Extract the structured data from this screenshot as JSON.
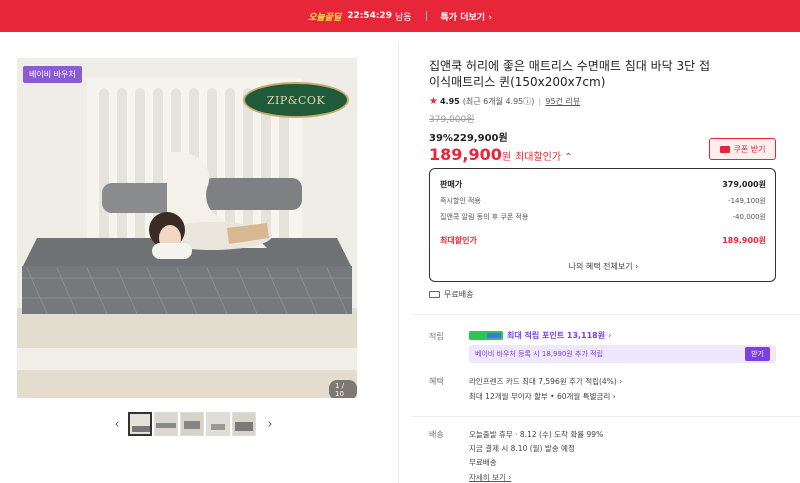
{
  "topbar": {
    "brand": "오늘끝딜",
    "timer": "22:54:29",
    "timer_suffix": "남음",
    "link": "특가 더보기 ›"
  },
  "gallery": {
    "badge": "베이비 바우처",
    "logo_text": "ZIP&COK",
    "counter": "1 / 10",
    "prev_icon": "‹",
    "next_icon": "›"
  },
  "product": {
    "title": "집앤쿡 허리에 좋은 매트리스 수면매트 침대 바닥 3단 접이식매트리스 퀸(150x200x7cm)",
    "rating_score": "4.95",
    "rating_recent": "(최근 6개월 4.95ⓘ)",
    "reviews": "95건 리뷰",
    "original_price": "379,000원",
    "discount_line_pct": "39%",
    "discount_line_price": "229,900원",
    "max_price": "189,900",
    "max_price_won": "원",
    "max_label": "최대할인가 ⌃",
    "coupon_label": "쿠폰 받기"
  },
  "price_box": {
    "rows": [
      {
        "label": "판매가",
        "value": "379,000원"
      },
      {
        "label": "즉시할인 적용",
        "value": "-149,100원"
      },
      {
        "label": "집앤쿡 알림 동의 후 쿠폰 적용",
        "value": "-40,000원"
      }
    ],
    "final_label": "최대할인가",
    "final_value": "189,900원",
    "more_link": "나의 혜택 전체보기 ›"
  },
  "shipping_top": "무료배송",
  "points": {
    "label": "적립",
    "text": "최대 적립 포인트 13,118원",
    "chev": "›",
    "banner_text": "베이비 바우처 등록 시 18,990원 추가 적립",
    "banner_btn": "받기"
  },
  "benefits": {
    "label": "혜택",
    "line1": "라인프렌즈 카드 최대 7,596원 추가 적립(4%) ›",
    "line2": "최대 12개월 무이자 할부 • 60개월 특별금리 ›"
  },
  "delivery": {
    "label": "배송",
    "line1": "오늘출발 휴무 · 8.12 (수) 도착 확률 99%",
    "line2": "지금 결제 시 8.10 (월) 발송 예정",
    "line3": "무료배송",
    "more": "자세히 보기 ›"
  },
  "colors": {
    "accent": "#e8263a",
    "purple": "#7b3fe4"
  }
}
